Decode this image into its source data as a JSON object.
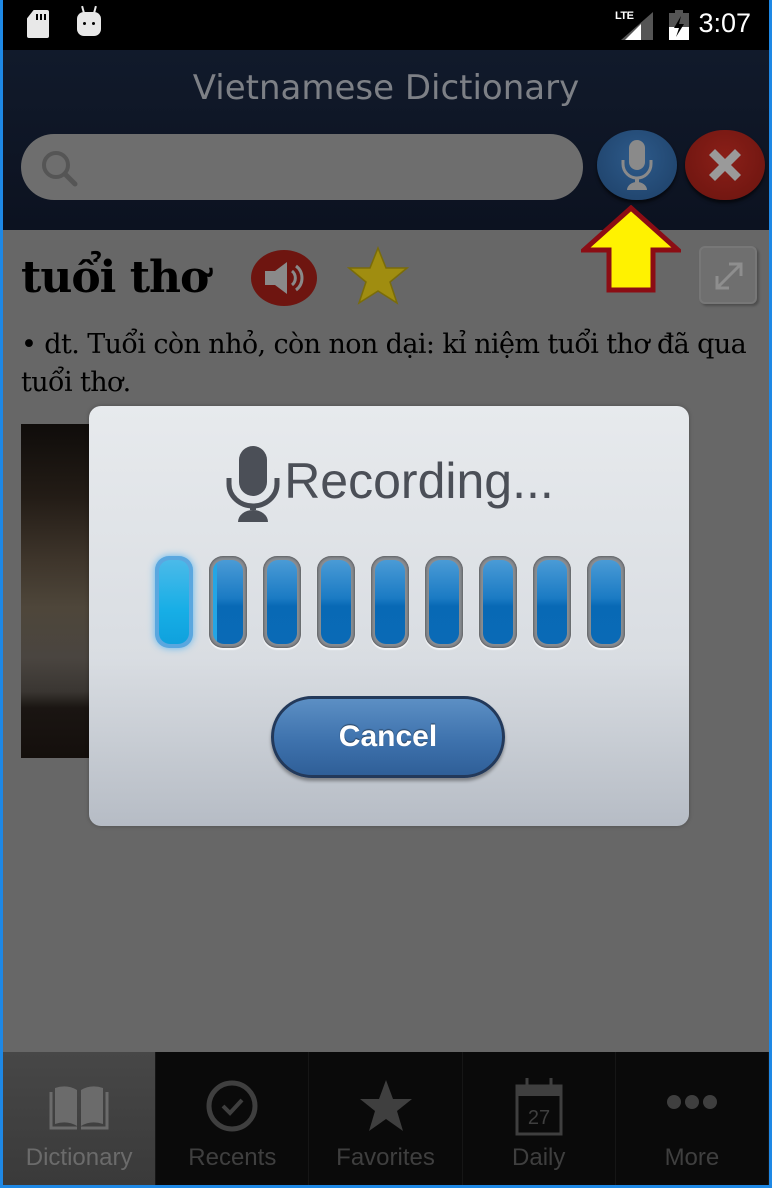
{
  "status_bar": {
    "time": "3:07",
    "network_label": "LTE",
    "icons": [
      "sd-card-icon",
      "android-debug-icon",
      "lte-signal-icon",
      "battery-charging-icon"
    ]
  },
  "header": {
    "title": "Vietnamese Dictionary",
    "search": {
      "value": "",
      "placeholder": ""
    },
    "voice_button_icon": "microphone-icon",
    "clear_button_icon": "close-icon"
  },
  "entry": {
    "headword": "tuổi thơ",
    "definition": "• dt. Tuổi còn nhỏ, còn non dại: kỉ niệm tuổi thơ đã qua tuổi thơ.",
    "actions": [
      "speaker-icon",
      "star-icon",
      "expand-icon"
    ]
  },
  "annotation": {
    "type": "arrow",
    "color": "#fff200",
    "outline": "#8b0d14",
    "points_to": "voice-search-button"
  },
  "recording_dialog": {
    "title": "Recording...",
    "level_bars_total": 9,
    "level_bars_active": 1.3,
    "cancel_label": "Cancel"
  },
  "bottom_nav": {
    "selected": "Dictionary",
    "items": [
      {
        "label": "Dictionary",
        "icon": "book-icon"
      },
      {
        "label": "Recents",
        "icon": "clock-check-icon"
      },
      {
        "label": "Favorites",
        "icon": "star-icon"
      },
      {
        "label": "Daily",
        "icon": "calendar-icon",
        "icon_text": "27"
      },
      {
        "label": "More",
        "icon": "more-dots-icon"
      }
    ]
  }
}
